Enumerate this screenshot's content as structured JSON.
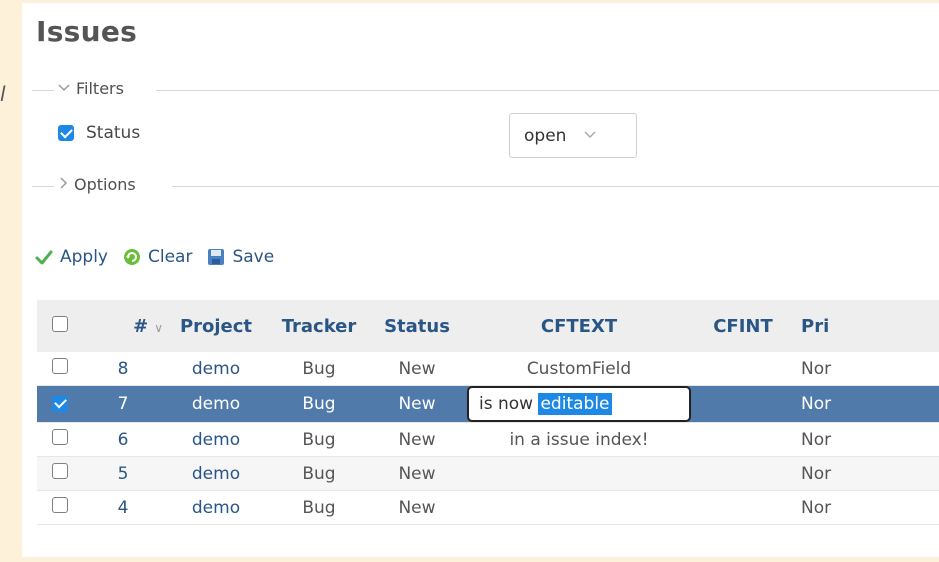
{
  "page_title": "Issues",
  "stray_char": "l",
  "filters": {
    "legend": "Filters",
    "status_label": "Status",
    "status_checked": true,
    "status_operator": "open"
  },
  "options": {
    "legend": "Options"
  },
  "actions": {
    "apply": "Apply",
    "clear": "Clear",
    "save": "Save"
  },
  "table": {
    "headers": {
      "id": "#",
      "project": "Project",
      "tracker": "Tracker",
      "status": "Status",
      "cftext": "CFTEXT",
      "cfint": "CFINT",
      "priority": "Pri"
    },
    "rows": [
      {
        "id": "8",
        "project": "demo",
        "tracker": "Bug",
        "status": "New",
        "cftext": "CustomField",
        "cfint": "",
        "priority": "Nor"
      },
      {
        "id": "7",
        "project": "demo",
        "tracker": "Bug",
        "status": "New",
        "cftext_plain": "is now ",
        "cftext_selected": "editable",
        "cfint": "",
        "priority": "Nor"
      },
      {
        "id": "6",
        "project": "demo",
        "tracker": "Bug",
        "status": "New",
        "cftext": "in a issue index!",
        "cfint": "",
        "priority": "Nor"
      },
      {
        "id": "5",
        "project": "demo",
        "tracker": "Bug",
        "status": "New",
        "cftext": "",
        "cfint": "",
        "priority": "Nor"
      },
      {
        "id": "4",
        "project": "demo",
        "tracker": "Bug",
        "status": "New",
        "cftext": "",
        "cfint": "",
        "priority": "Nor"
      }
    ]
  },
  "colors": {
    "background": "#fdf2d9",
    "link": "#2a5685",
    "selected_row": "#507aaa",
    "checkbox": "#1e88e5"
  },
  "icons": [
    "chevron-down-icon",
    "chevron-right-icon",
    "checkmark-icon",
    "refresh-icon",
    "save-disk-icon"
  ]
}
